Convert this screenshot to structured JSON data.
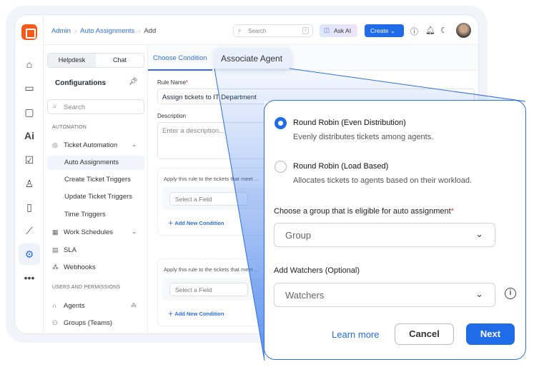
{
  "breadcrumb": {
    "items": [
      "Admin",
      "Auto Assignments"
    ],
    "current": "Add"
  },
  "topbar": {
    "search_placeholder": "Search",
    "search_shortcut": "/",
    "ask_ai": "Ask AI",
    "create": "Create"
  },
  "sidebar": {
    "tabs": [
      "Helpdesk",
      "Chat"
    ],
    "title": "Configurations",
    "search_placeholder": "Search",
    "sections": [
      "AUTOMATION",
      "USERS AND PERMISSIONS"
    ],
    "items": [
      "Ticket Automation",
      "Auto Assignments",
      "Create Ticket Triggers",
      "Update Ticket Triggers",
      "Time Triggers",
      "Work Schedules",
      "SLA",
      "Webhooks",
      "Agents",
      "Groups (Teams)"
    ]
  },
  "main": {
    "tabs": [
      "Choose Condition",
      "Associate Agent"
    ],
    "rule_name_label": "Rule Name",
    "rule_name_value": "Assign tickets to IT Department",
    "description_label": "Description",
    "description_placeholder": "Enter a description...",
    "condition_text": "Apply this rule to the tickets that meet ...",
    "select_field": "Select a Field",
    "add_condition": "Add New Condition"
  },
  "card": {
    "options": [
      {
        "label": "Round Robin (Even Distribution)",
        "desc": "Evenly distributes tickets among agents."
      },
      {
        "label": "Round Robin (Load Based)",
        "desc": "Allocates tickets to agents based on their workload."
      }
    ],
    "group_label": "Choose a group that is eligible for auto assignment",
    "group_placeholder": "Group",
    "watchers_label": "Add Watchers (Optional)",
    "watchers_placeholder": "Watchers",
    "learn_more": "Learn more",
    "cancel": "Cancel",
    "next": "Next"
  },
  "colors": {
    "accent": "#1f6be8",
    "brand": "#f25a1a"
  }
}
